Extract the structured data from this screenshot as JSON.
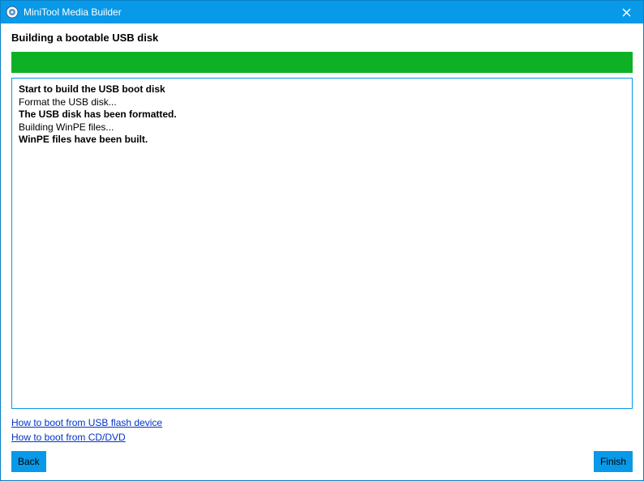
{
  "window": {
    "title": "MiniTool Media Builder"
  },
  "page": {
    "heading": "Building a bootable USB disk"
  },
  "progress": {
    "percent": 100
  },
  "log": {
    "lines": [
      {
        "text": "Start to build the USB boot disk",
        "bold": true
      },
      {
        "text": "Format the USB disk...",
        "bold": false
      },
      {
        "text": "The USB disk has been formatted.",
        "bold": true
      },
      {
        "text": "Building WinPE files...",
        "bold": false
      },
      {
        "text": "WinPE files have been built.",
        "bold": true
      }
    ]
  },
  "links": {
    "usb": "How to boot from USB flash device",
    "cd": "How to boot from CD/DVD"
  },
  "buttons": {
    "back": "Back",
    "finish": "Finish"
  }
}
